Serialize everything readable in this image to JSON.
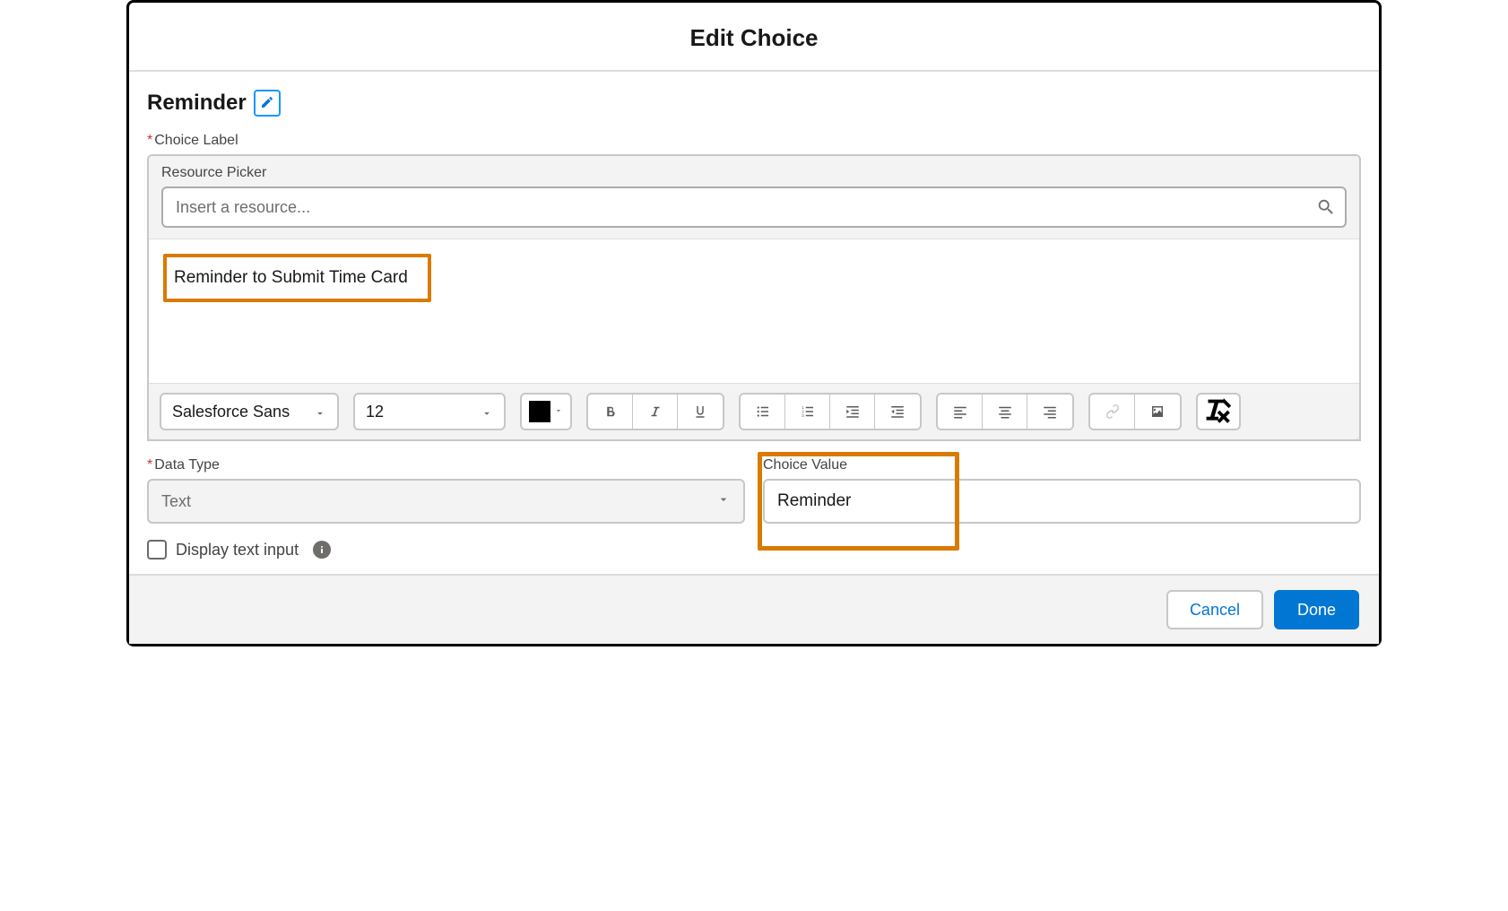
{
  "modal": {
    "title": "Edit Choice"
  },
  "resource": {
    "name": "Reminder"
  },
  "choice_label": {
    "field_label": "Choice Label",
    "picker_label": "Resource Picker",
    "picker_placeholder": "Insert a resource...",
    "rich_text_value": "Reminder to Submit Time Card"
  },
  "toolbar": {
    "font": "Salesforce Sans",
    "size": "12"
  },
  "data_type": {
    "label": "Data Type",
    "value": "Text"
  },
  "choice_value": {
    "label": "Choice Value",
    "value": "Reminder"
  },
  "display_text_input": {
    "label": "Display text input",
    "checked": false
  },
  "footer": {
    "cancel": "Cancel",
    "done": "Done"
  },
  "colors": {
    "highlight": "#d97b00",
    "primary": "#0176d3"
  }
}
